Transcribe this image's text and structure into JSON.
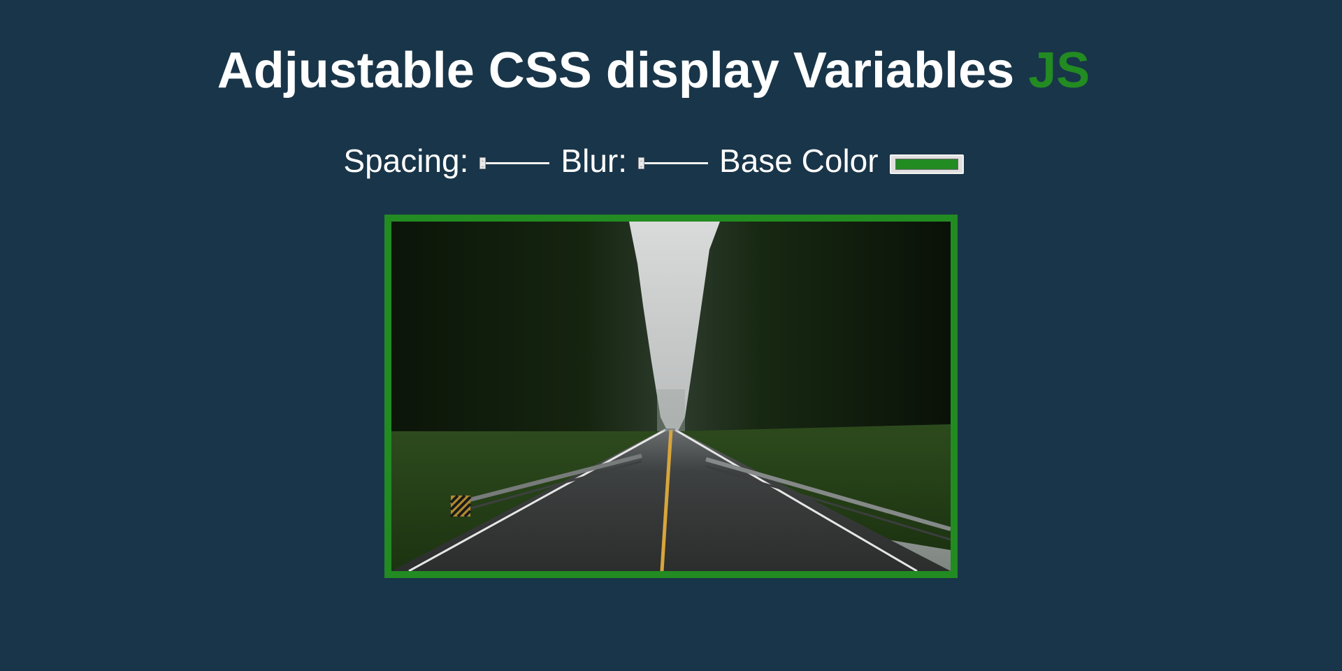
{
  "header": {
    "title_main": "Adjustable CSS display Variables",
    "title_highlight": "JS"
  },
  "controls": {
    "spacing_label": "Spacing:",
    "blur_label": "Blur:",
    "base_color_label": "Base Color",
    "base_color_value": "#228b22",
    "spacing_level": 0,
    "blur_level": 0
  },
  "photo": {
    "description_icon": "road-through-forest-photo"
  },
  "colors": {
    "background": "#193549",
    "accent": "#228b22",
    "text": "#ffffff"
  }
}
